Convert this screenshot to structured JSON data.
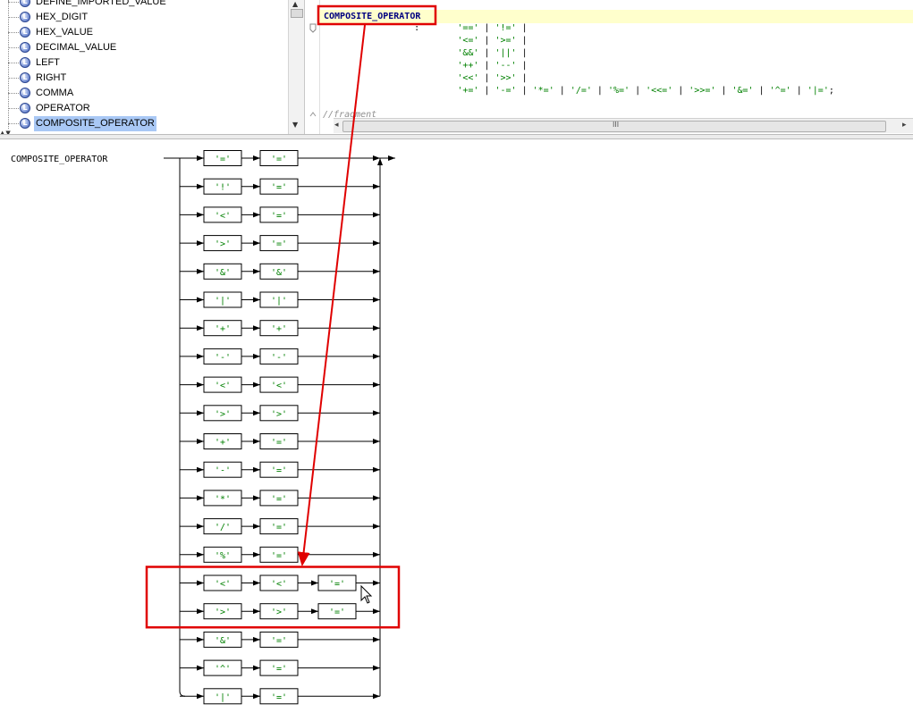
{
  "tree": {
    "items": [
      {
        "label": "DEFINE_IMPORTED_VALUE",
        "selected": false
      },
      {
        "label": "HEX_DIGIT",
        "selected": false
      },
      {
        "label": "HEX_VALUE",
        "selected": false
      },
      {
        "label": "DECIMAL_VALUE",
        "selected": false
      },
      {
        "label": "LEFT",
        "selected": false
      },
      {
        "label": "RIGHT",
        "selected": false
      },
      {
        "label": "COMMA",
        "selected": false
      },
      {
        "label": "OPERATOR",
        "selected": false
      },
      {
        "label": "COMPOSITE_OPERATOR",
        "selected": true
      }
    ],
    "icon": "lexer-rule-icon",
    "icon_glyph": "L"
  },
  "editor": {
    "lines": [
      [
        {
          "t": "COMPOSITE_OPERATOR",
          "c": "rule-name"
        }
      ],
      [
        {
          "t": "\t:\t",
          "c": "pun"
        },
        {
          "t": "'=='",
          "c": "lit"
        },
        {
          "t": " | ",
          "c": "pun"
        },
        {
          "t": "'!='",
          "c": "lit"
        },
        {
          "t": " |",
          "c": "pun"
        }
      ],
      [
        {
          "t": "\t\t",
          "c": "pun"
        },
        {
          "t": "'<='",
          "c": "lit"
        },
        {
          "t": " | ",
          "c": "pun"
        },
        {
          "t": "'>='",
          "c": "lit"
        },
        {
          "t": " |",
          "c": "pun"
        }
      ],
      [
        {
          "t": "\t\t",
          "c": "pun"
        },
        {
          "t": "'&&'",
          "c": "lit"
        },
        {
          "t": " | ",
          "c": "pun"
        },
        {
          "t": "'||'",
          "c": "lit"
        },
        {
          "t": " |",
          "c": "pun"
        }
      ],
      [
        {
          "t": "\t\t",
          "c": "pun"
        },
        {
          "t": "'++'",
          "c": "lit"
        },
        {
          "t": " | ",
          "c": "pun"
        },
        {
          "t": "'--'",
          "c": "lit"
        },
        {
          "t": " |",
          "c": "pun"
        }
      ],
      [
        {
          "t": "\t\t",
          "c": "pun"
        },
        {
          "t": "'<<'",
          "c": "lit"
        },
        {
          "t": " | ",
          "c": "pun"
        },
        {
          "t": "'>>'",
          "c": "lit"
        },
        {
          "t": " |",
          "c": "pun"
        }
      ],
      [
        {
          "t": "\t\t",
          "c": "pun"
        },
        {
          "t": "'+='",
          "c": "lit"
        },
        {
          "t": " | ",
          "c": "pun"
        },
        {
          "t": "'-='",
          "c": "lit"
        },
        {
          "t": " | ",
          "c": "pun"
        },
        {
          "t": "'*='",
          "c": "lit"
        },
        {
          "t": " | ",
          "c": "pun"
        },
        {
          "t": "'/='",
          "c": "lit"
        },
        {
          "t": " | ",
          "c": "pun"
        },
        {
          "t": "'%='",
          "c": "lit"
        },
        {
          "t": " | ",
          "c": "pun"
        },
        {
          "t": "'<<='",
          "c": "lit"
        },
        {
          "t": " | ",
          "c": "pun"
        },
        {
          "t": "'>>='",
          "c": "lit"
        },
        {
          "t": " | ",
          "c": "pun"
        },
        {
          "t": "'&='",
          "c": "lit"
        },
        {
          "t": " | ",
          "c": "pun"
        },
        {
          "t": "'^='",
          "c": "lit"
        },
        {
          "t": " | ",
          "c": "pun"
        },
        {
          "t": "'|='",
          "c": "lit"
        },
        {
          "t": ";",
          "c": "pun"
        }
      ],
      [
        {
          "t": "//fragment",
          "c": "cmt"
        }
      ]
    ],
    "scroll_grip": "III"
  },
  "diagram": {
    "rule_name": "COMPOSITE_OPERATOR",
    "alternatives": [
      [
        "'='",
        "'='"
      ],
      [
        "'!'",
        "'='"
      ],
      [
        "'<'",
        "'='"
      ],
      [
        "'>'",
        "'='"
      ],
      [
        "'&'",
        "'&'"
      ],
      [
        "'|'",
        "'|'"
      ],
      [
        "'+'",
        "'+'"
      ],
      [
        "'-'",
        "'-'"
      ],
      [
        "'<'",
        "'<'"
      ],
      [
        "'>'",
        "'>'"
      ],
      [
        "'+'",
        "'='"
      ],
      [
        "'-'",
        "'='"
      ],
      [
        "'*'",
        "'='"
      ],
      [
        "'/'",
        "'='"
      ],
      [
        "'%'",
        "'='"
      ],
      [
        "'<'",
        "'<'",
        "'='"
      ],
      [
        "'>'",
        "'>'",
        "'='"
      ],
      [
        "'&'",
        "'='"
      ],
      [
        "'^'",
        "'='"
      ],
      [
        "'|'",
        "'='"
      ]
    ],
    "highlighted_alternatives": [
      15,
      16
    ],
    "highlight_color": "#e00000",
    "token_color": "#008000"
  }
}
